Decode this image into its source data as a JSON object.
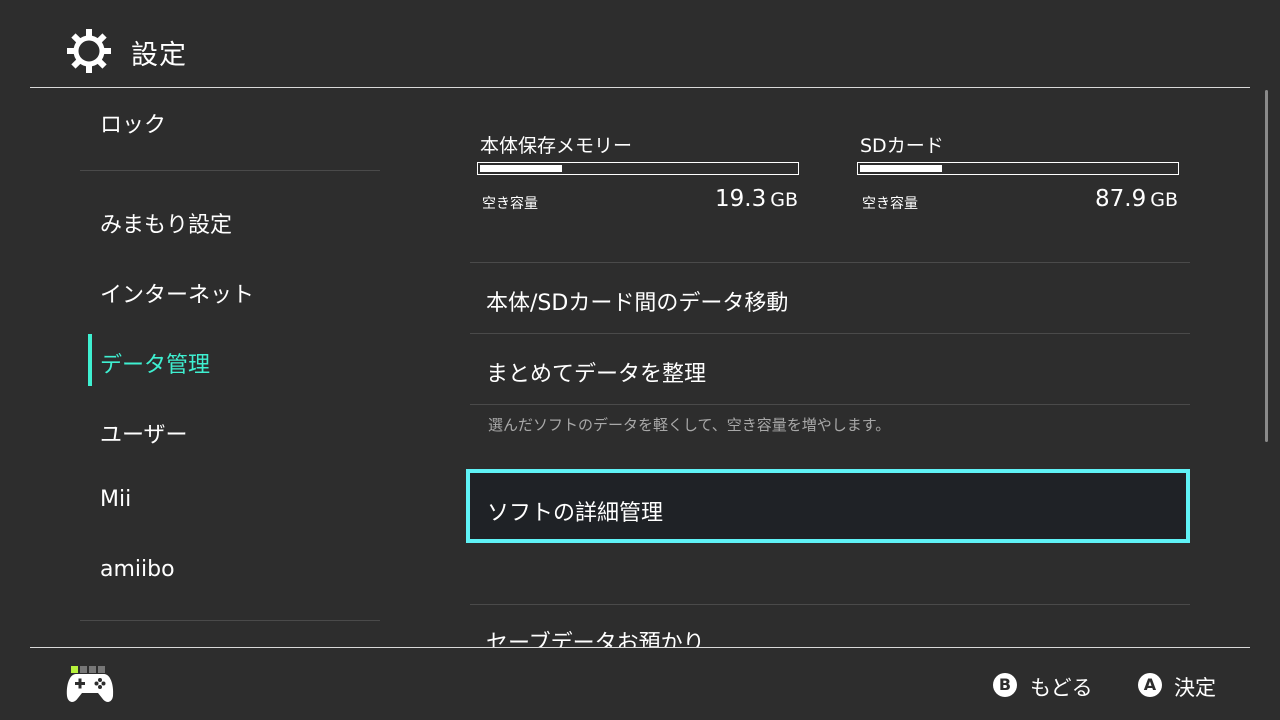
{
  "header": {
    "title": "設定",
    "icon": "gear-icon"
  },
  "sidebar": {
    "items": [
      {
        "label": "ロック"
      },
      {
        "label": "みまもり設定"
      },
      {
        "label": "インターネット"
      },
      {
        "label": "データ管理",
        "active": true
      },
      {
        "label": "ユーザー"
      },
      {
        "label": "Mii"
      },
      {
        "label": "amiibo"
      }
    ],
    "accent": "#3ef0d1"
  },
  "storage": {
    "system": {
      "label": "本体保存メモリー",
      "free_label": "空き容量",
      "free_value": "19.3",
      "unit": "GB",
      "used_fraction": 0.26
    },
    "sd": {
      "label": "SDカード",
      "free_label": "空き容量",
      "free_value": "87.9",
      "unit": "GB",
      "used_fraction": 0.26
    }
  },
  "menu": {
    "move_data": "本体/SDカード間のデータ移動",
    "organize": "まとめてデータを整理",
    "organize_hint": "選んだソフトのデータを軽くして、空き容量を増やします。",
    "software_mgmt": "ソフトの詳細管理",
    "save_backup": "セーブデータお預かり"
  },
  "footer": {
    "b_key": "B",
    "back_label": "もどる",
    "a_key": "A",
    "ok_label": "決定"
  },
  "colors": {
    "background": "#2d2d2d",
    "selection_border": "#5ff2f6",
    "active_text": "#3ef0d1"
  }
}
